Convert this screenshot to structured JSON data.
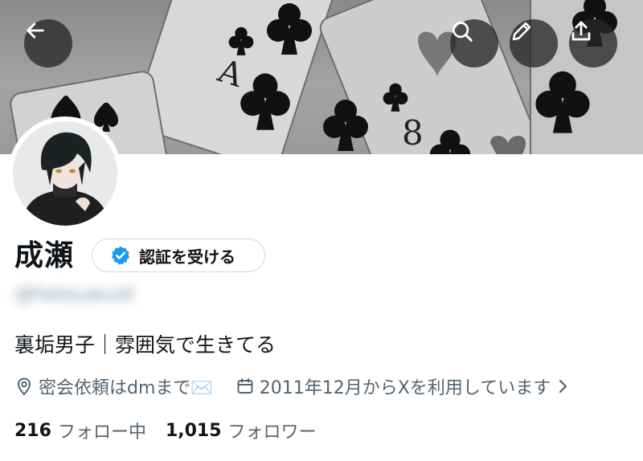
{
  "profile": {
    "display_name": "成瀬",
    "verify_button_label": "認証を受ける",
    "handle": "@hetsuwuid",
    "bio": "裏垢男子｜雰囲気で生きてる",
    "location": "密会依頼はdmまで✉️",
    "joined": "2011年12月からXを利用しています",
    "following_count": "216",
    "following_label": "フォロー中",
    "followers_count": "1,015",
    "followers_label": "フォロワー"
  },
  "banner": {
    "card_ranks": [
      "A",
      "8"
    ],
    "suit": "club"
  },
  "header_buttons": {
    "back": "arrow-left-icon",
    "search": "search-icon",
    "edit": "pencil-icon",
    "share": "share-icon"
  },
  "colors": {
    "verified_badge": "#1d9bf0",
    "text_primary": "#0f1419",
    "text_secondary": "#536471",
    "border": "#cfd9de"
  }
}
